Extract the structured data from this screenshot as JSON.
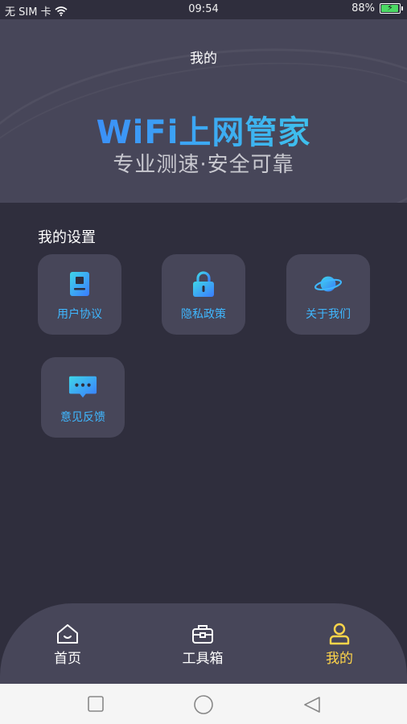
{
  "status_bar": {
    "carrier": "无 SIM 卡",
    "time": "09:54",
    "battery": "88%"
  },
  "header": {
    "title": "我的"
  },
  "banner": {
    "brand": "WiFi上网管家",
    "slogan": "专业测速·安全可靠"
  },
  "settings": {
    "title": "我的设置",
    "items": [
      {
        "label": "用户协议",
        "icon": "document-icon"
      },
      {
        "label": "隐私政策",
        "icon": "lock-icon"
      },
      {
        "label": "关于我们",
        "icon": "planet-icon"
      },
      {
        "label": "意见反馈",
        "icon": "chat-bubble-icon"
      }
    ]
  },
  "tabbar": {
    "tabs": [
      {
        "label": "首页",
        "icon": "home-icon"
      },
      {
        "label": "工具箱",
        "icon": "toolbox-icon"
      },
      {
        "label": "我的",
        "icon": "user-icon"
      }
    ],
    "active_index": 2,
    "active_color": "#ffd54a"
  },
  "colors": {
    "background": "#2f2e3d",
    "card": "#474659",
    "accent": "#3fb7ff"
  }
}
